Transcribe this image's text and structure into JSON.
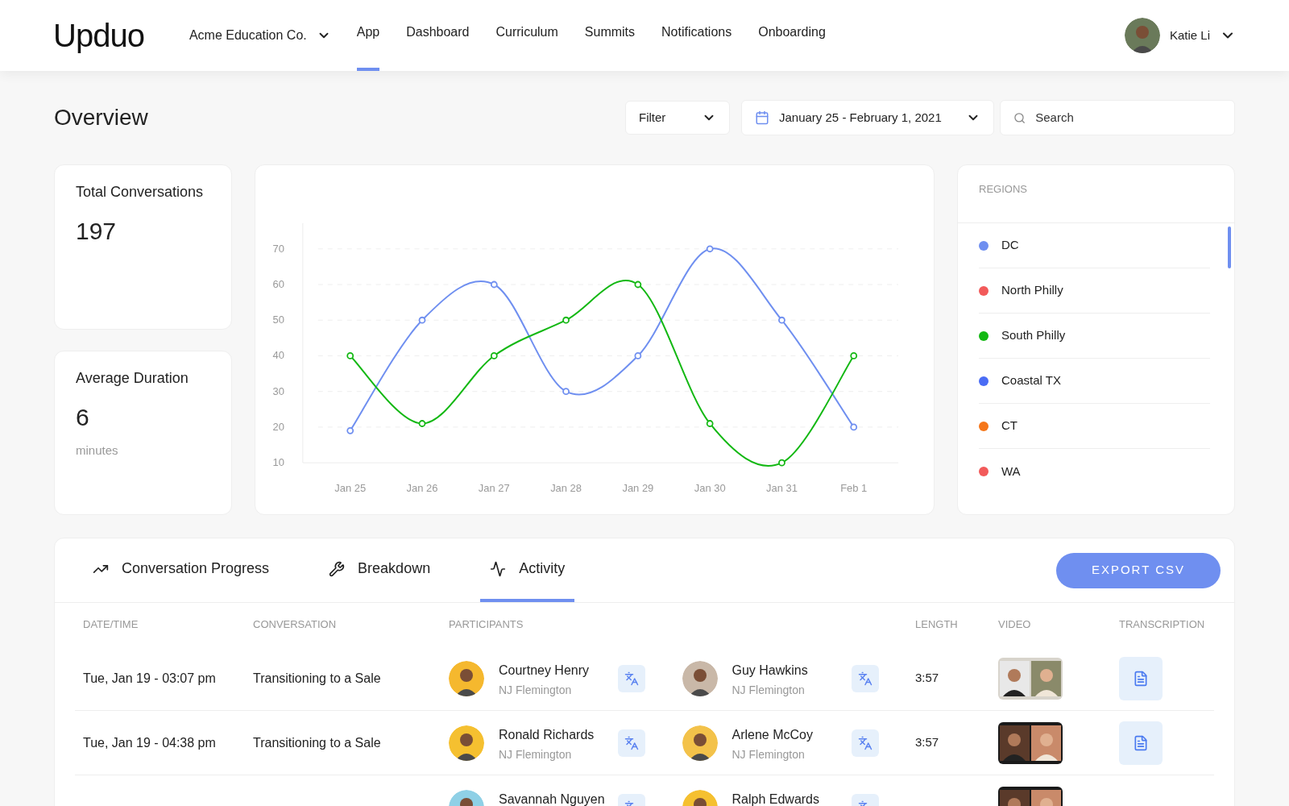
{
  "header": {
    "logo": "Upduo",
    "organization": "Acme Education Co.",
    "nav": [
      {
        "label": "App",
        "selected": true
      },
      {
        "label": "Dashboard",
        "selected": false
      },
      {
        "label": "Curriculum",
        "selected": false
      },
      {
        "label": "Summits",
        "selected": false
      },
      {
        "label": "Notifications",
        "selected": false
      },
      {
        "label": "Onboarding",
        "selected": false
      }
    ],
    "user": {
      "name": "Katie Li"
    }
  },
  "toolbar": {
    "title": "Overview",
    "filter": "Filter",
    "date_range": "January 25 - February 1, 2021",
    "search": {
      "placeholder": "Search"
    }
  },
  "stats": [
    {
      "label": "Total Conversations",
      "value": "197"
    },
    {
      "label": "Average Duration",
      "value": "6",
      "unit": "minutes"
    }
  ],
  "chart": {
    "chart_data": {
      "type": "line",
      "categories": [
        "Jan 25",
        "Jan 26",
        "Jan 27",
        "Jan 28",
        "Jan 29",
        "Jan 30",
        "Jan 31",
        "Feb 1"
      ],
      "ylim": [
        10,
        70
      ],
      "yticks": [
        10,
        20,
        30,
        40,
        50,
        60,
        70
      ],
      "grid": true,
      "series": [
        {
          "color": "#6f8ff0",
          "marker": true,
          "values": [
            19,
            50,
            60,
            30,
            40,
            70,
            50,
            20
          ]
        },
        {
          "color": "#13b813",
          "marker": true,
          "values": [
            40,
            21,
            40,
            50,
            60,
            21,
            10,
            40
          ]
        }
      ]
    }
  },
  "regions": {
    "title": "REGIONS",
    "items": [
      {
        "name": "DC",
        "color": "#6f8ff0"
      },
      {
        "name": "North Philly",
        "color": "#f25a5a"
      },
      {
        "name": "South Philly",
        "color": "#13b813"
      },
      {
        "name": "Coastal TX",
        "color": "#4a6cf5"
      },
      {
        "name": "CT",
        "color": "#f5761a"
      },
      {
        "name": "WA",
        "color": "#f25a5a"
      }
    ]
  },
  "activity": {
    "tabs": [
      {
        "label": "Conversation Progress",
        "selected": false
      },
      {
        "label": "Breakdown",
        "selected": false
      },
      {
        "label": "Activity",
        "selected": true
      }
    ],
    "export_button": "EXPORT CSV",
    "columns": [
      "DATE/TIME",
      "CONVERSATION",
      "PARTICIPANTS",
      "LENGTH",
      "VIDEO",
      "TRANSCRIPTION"
    ],
    "rows": [
      {
        "date_time": "Tue, Jan 19 - 03:07 pm",
        "conversation": "Transitioning to a Sale",
        "participants": [
          {
            "name": "Courtney Henry",
            "location": "NJ Flemington"
          },
          {
            "name": "Guy Hawkins",
            "location": "NJ Flemington"
          }
        ],
        "length": "3:57",
        "video": {
          "kind": "picture"
        },
        "transcription": true
      },
      {
        "date_time": "Tue, Jan 19 - 04:38 pm",
        "conversation": "Transitioning to a Sale",
        "participants": [
          {
            "name": "Ronald Richards",
            "location": "NJ Flemington"
          },
          {
            "name": "Arlene McCoy",
            "location": "NJ Flemington"
          }
        ],
        "length": "3:57",
        "video": {
          "kind": "picture"
        },
        "transcription": true
      },
      {
        "participants": [
          {
            "name": "Savannah Nguyen"
          },
          {
            "name": "Ralph Edwards"
          }
        ],
        "video": {
          "kind": "picture"
        }
      }
    ]
  }
}
